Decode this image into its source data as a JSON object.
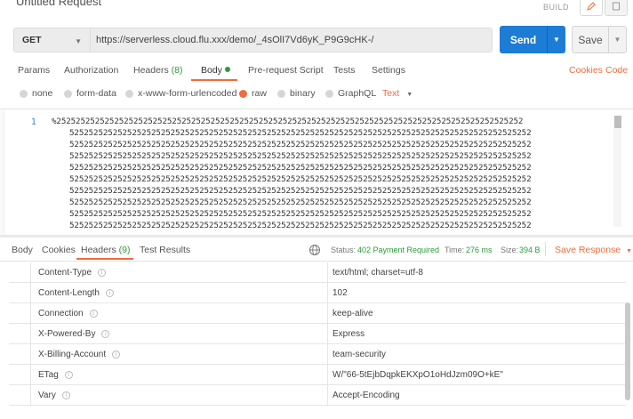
{
  "request": {
    "title": "Untitled Request",
    "build_label": "BUILD",
    "method": "GET",
    "url": "https://serverless.cloud.flu.xxx/demo/_4sOlI7Vd6yK_P9G9cHK-/",
    "send_label": "Send",
    "save_label": "Save"
  },
  "request_tabs": {
    "params": "Params",
    "authorization": "Authorization",
    "headers": "Headers",
    "headers_count": "(8)",
    "body": "Body",
    "prerequest": "Pre-request Script",
    "tests": "Tests",
    "settings": "Settings",
    "cookies": "Cookies",
    "code": "Code"
  },
  "body_types": {
    "none": "none",
    "form_data": "form-data",
    "urlencoded": "x-www-form-urlencoded",
    "raw": "raw",
    "binary": "binary",
    "graphql": "GraphQL",
    "selected": "raw",
    "format": "Text"
  },
  "editor": {
    "line_number": "1",
    "first_line": "%2525252525252525252525252525252525252525252525252525252525252525252525252525252525252525252525252",
    "wrapped_lines": [
      "525252525252525252525252525252525252525252525252525252525252525252525252525252525252525252525252",
      "525252525252525252525252525252525252525252525252525252525252525252525252525252525252525252525252",
      "525252525252525252525252525252525252525252525252525252525252525252525252525252525252525252525252",
      "525252525252525252525252525252525252525252525252525252525252525252525252525252525252525252525252",
      "525252525252525252525252525252525252525252525252525252525252525252525252525252525252525252525252",
      "525252525252525252525252525252525252525252525252525252525252525252525252525252525252525252525252",
      "525252525252525252525252525252525252525252525252525252525252525252525252525252525252525252525252",
      "525252525252525252525252525252525252525252525252525252525252525252525252525252525252525252525252",
      "525252525252525252525252525252525252525252525252525252525252525252525252525252525252525252525252"
    ]
  },
  "response": {
    "tabs": {
      "body": "Body",
      "cookies": "Cookies",
      "headers": "Headers",
      "headers_count": "(9)",
      "test_results": "Test Results"
    },
    "status_label": "Status:",
    "status_value": "402 Payment Required",
    "time_label": "Time:",
    "time_value": "276 ms",
    "size_label": "Size:",
    "size_value": "394 B",
    "save_response": "Save Response",
    "headers": [
      {
        "key": "Content-Type",
        "value": "text/html; charset=utf-8"
      },
      {
        "key": "Content-Length",
        "value": "102"
      },
      {
        "key": "Connection",
        "value": "keep-alive"
      },
      {
        "key": "X-Powered-By",
        "value": "Express"
      },
      {
        "key": "X-Billing-Account",
        "value": "team-security"
      },
      {
        "key": "ETag",
        "value": "W/\"66-5tEjbDqpkEKXpO1oHdJzm09O+kE\""
      },
      {
        "key": "Vary",
        "value": "Accept-Encoding"
      }
    ]
  },
  "colors": {
    "accent": "#f26b3a",
    "send": "#1d7cd6",
    "success": "#2d9b3a"
  }
}
